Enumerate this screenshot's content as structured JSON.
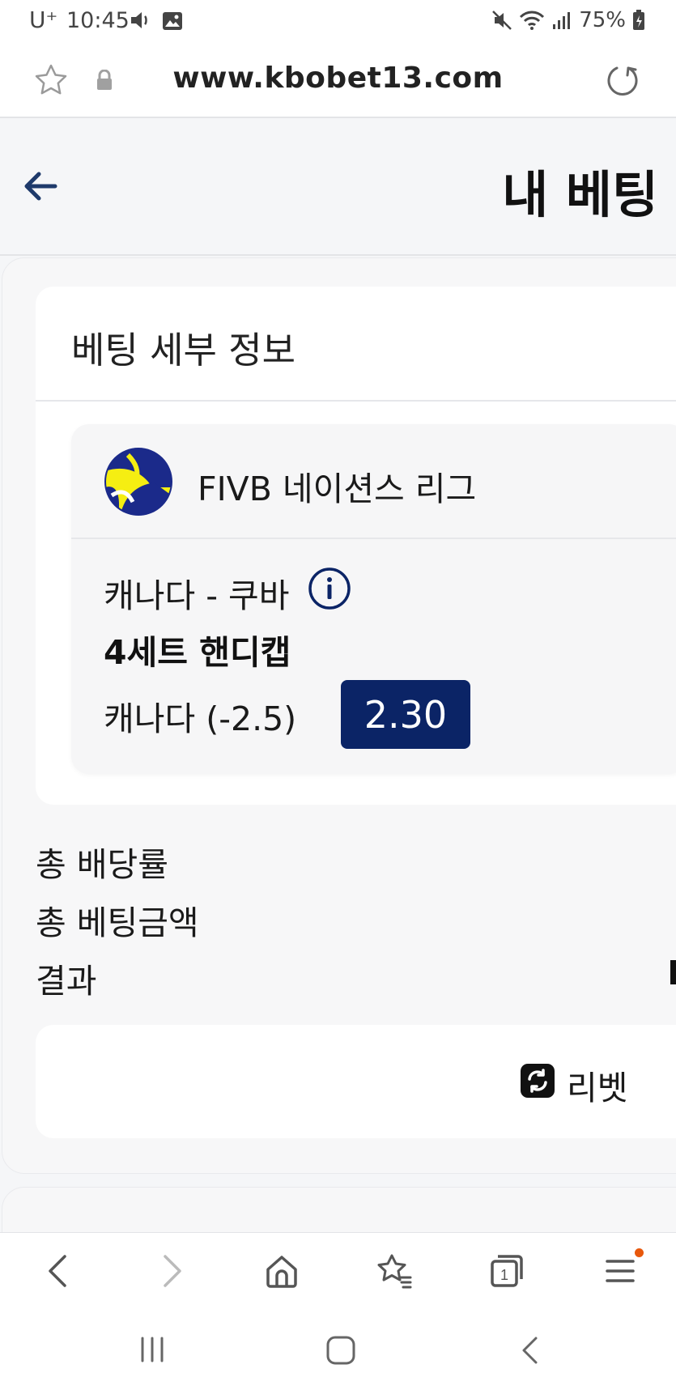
{
  "status_bar": {
    "carrier": "U⁺",
    "time": "10:45",
    "battery": "75%"
  },
  "browser": {
    "url": "www.kbobet13.com"
  },
  "header": {
    "title": "내 베팅"
  },
  "bet_details": {
    "section_title": "베팅 세부 정보",
    "league": "FIVB 네이션스 리그",
    "match": "캐나다 - 쿠바",
    "market": "4세트 핸디캡",
    "selection": "캐나다 (-2.5)",
    "odds": "2.30"
  },
  "summary": {
    "total_odds_label": "총 배당률",
    "total_stake_label": "총 베팅금액",
    "result_label": "결과"
  },
  "actions": {
    "rebet_label": "리벳"
  },
  "colors": {
    "odds_bg": "#0b2466",
    "back_arrow": "#1e3a6b",
    "notification_dot": "#e8580c"
  }
}
